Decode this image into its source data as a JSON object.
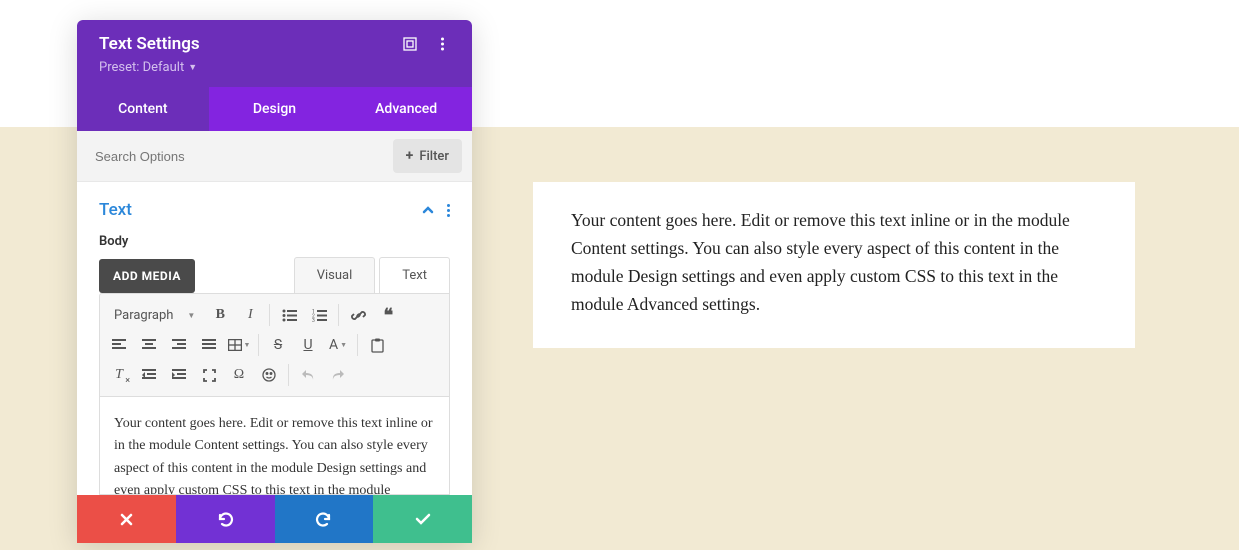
{
  "panel": {
    "title": "Text Settings",
    "preset_label": "Preset: Default"
  },
  "tabs": {
    "content": "Content",
    "design": "Design",
    "advanced": "Advanced"
  },
  "search": {
    "placeholder": "Search Options",
    "filter_label": "Filter"
  },
  "accordion": {
    "title": "Text",
    "body_label": "Body"
  },
  "editor": {
    "add_media": "ADD MEDIA",
    "tab_visual": "Visual",
    "tab_text": "Text",
    "format_value": "Paragraph",
    "font_color_label": "A",
    "content": "Your content goes here. Edit or remove this text inline or in the module Content settings. You can also style every aspect of this content in the module Design settings and even apply custom CSS to this text in the module Advanced settings."
  },
  "preview": {
    "text": "Your content goes here. Edit or remove this text inline or in the module Content settings. You can also style every aspect of this content in the module Design settings and even apply custom CSS to this text in the module Advanced settings."
  }
}
